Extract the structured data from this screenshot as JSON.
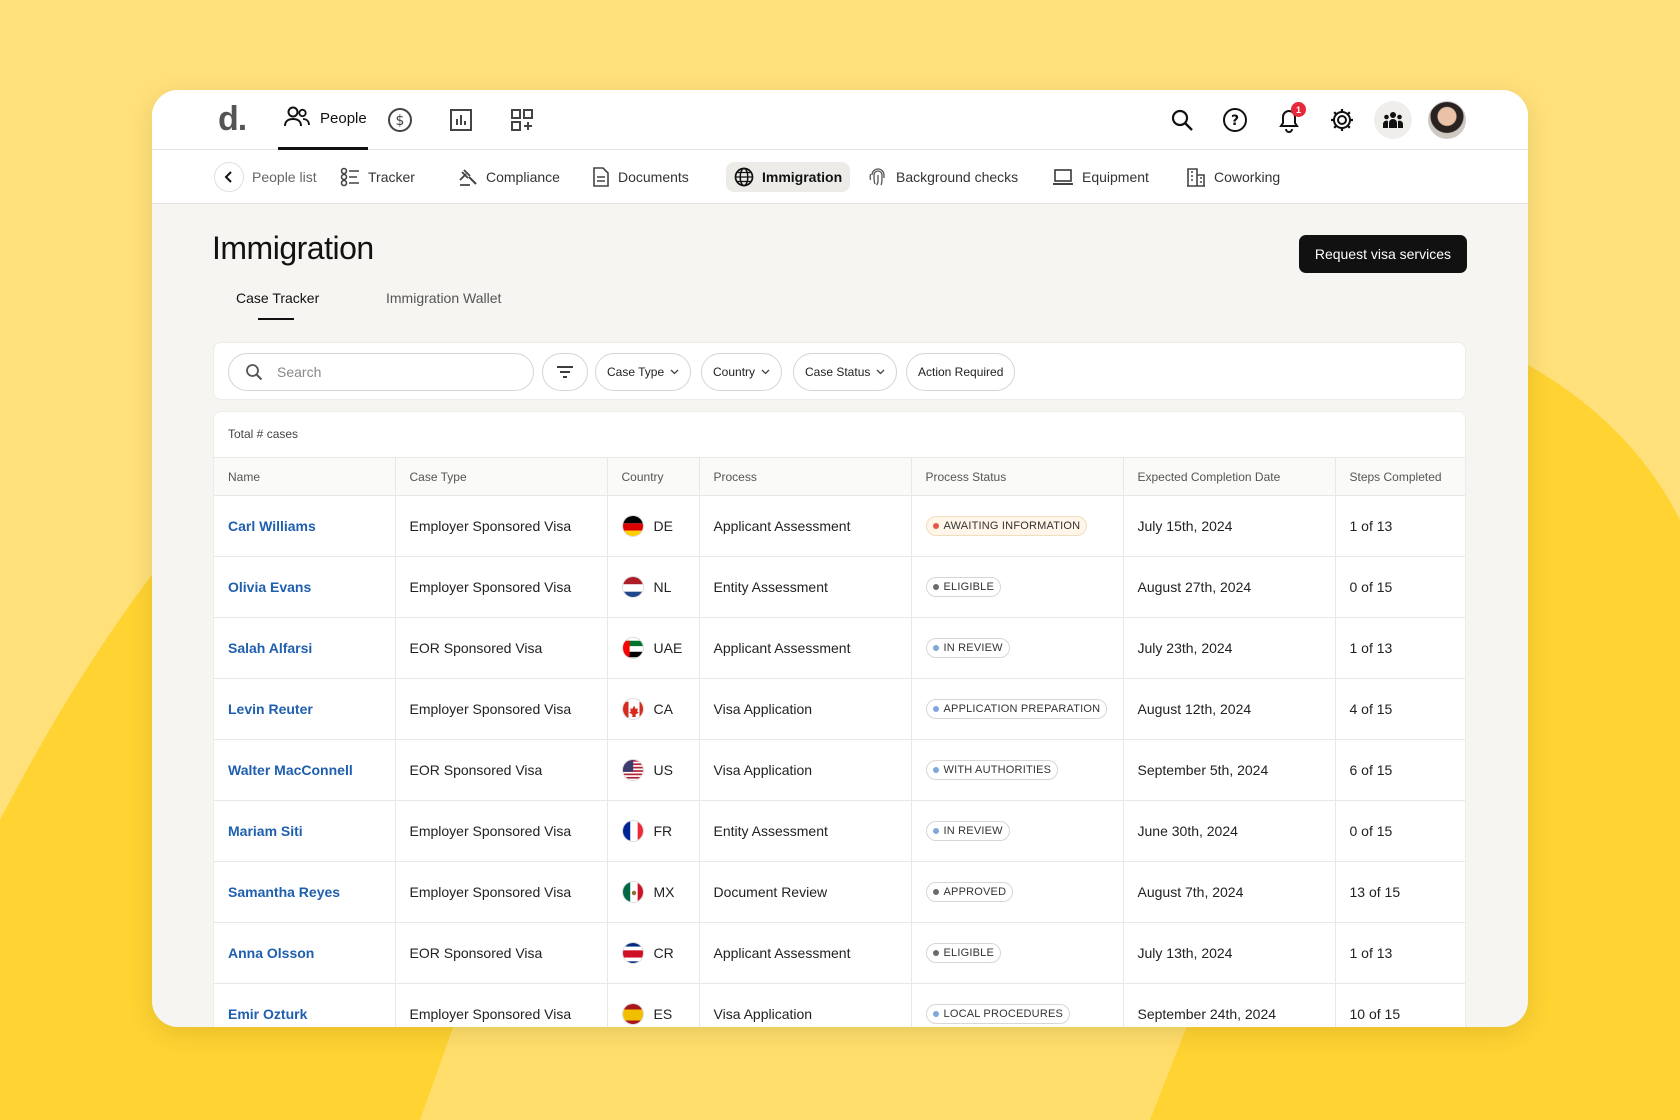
{
  "colors": {
    "accent": "#1F5FAF",
    "background": "#FFE07A",
    "dark": "#111111"
  },
  "topnav": {
    "logo": "d.",
    "active_tab": "People",
    "icons": [
      "people-icon",
      "dollar-icon",
      "chart-icon",
      "apps-icon"
    ],
    "right_icons": [
      "search-icon",
      "help-icon",
      "bell-icon",
      "gear-icon",
      "team-icon"
    ],
    "notification_count": "1"
  },
  "subnav": {
    "back_label": "People list",
    "items": [
      {
        "label": "Tracker",
        "icon": "tracker-icon"
      },
      {
        "label": "Compliance",
        "icon": "gavel-icon"
      },
      {
        "label": "Documents",
        "icon": "document-icon"
      },
      {
        "label": "Immigration",
        "icon": "globe-icon",
        "active": true
      },
      {
        "label": "Background checks",
        "icon": "fingerprint-icon"
      },
      {
        "label": "Equipment",
        "icon": "laptop-icon"
      },
      {
        "label": "Coworking",
        "icon": "building-icon"
      }
    ]
  },
  "page": {
    "title": "Immigration",
    "primary_button": "Request visa services",
    "tabs": [
      {
        "label": "Case Tracker",
        "active": true
      },
      {
        "label": "Immigration Wallet"
      }
    ]
  },
  "filters": {
    "search_placeholder": "Search",
    "chips": [
      "Case Type",
      "Country",
      "Case Status",
      "Action Required"
    ]
  },
  "table": {
    "total_label": "Total # cases",
    "columns": [
      "Name",
      "Case Type",
      "Country",
      "Process",
      "Process Status",
      "Expected Completion Date",
      "Steps Completed"
    ],
    "rows": [
      {
        "name": "Carl Williams",
        "case_type": "Employer Sponsored Visa",
        "country": "DE",
        "process": "Applicant Assessment",
        "status": "AWAITING INFORMATION",
        "status_color": "#E5574B",
        "date": "July 15th, 2024",
        "steps": "1 of 13"
      },
      {
        "name": "Olivia Evans",
        "case_type": "Employer Sponsored Visa",
        "country": "NL",
        "process": "Entity Assessment",
        "status": "ELIGIBLE",
        "status_color": "#6B6B6B",
        "date": "August 27th, 2024",
        "steps": "0 of 15"
      },
      {
        "name": "Salah Alfarsi",
        "case_type": "EOR Sponsored Visa",
        "country": "UAE",
        "process": "Applicant Assessment",
        "status": "IN REVIEW",
        "status_color": "#7FA7D9",
        "date": "July 23th, 2024",
        "steps": "1 of 13"
      },
      {
        "name": "Levin Reuter",
        "case_type": "Employer Sponsored Visa",
        "country": "CA",
        "process": "Visa Application",
        "status": "APPLICATION PREPARATION",
        "status_color": "#7FA7D9",
        "date": "August 12th, 2024",
        "steps": "4 of 15"
      },
      {
        "name": "Walter MacConnell",
        "case_type": "EOR Sponsored Visa",
        "country": "US",
        "process": "Visa Application",
        "status": "WITH AUTHORITIES",
        "status_color": "#7FA7D9",
        "date": "September 5th, 2024",
        "steps": "6 of 15"
      },
      {
        "name": "Mariam Siti",
        "case_type": "Employer Sponsored Visa",
        "country": "FR",
        "process": "Entity Assessment",
        "status": "IN REVIEW",
        "status_color": "#7FA7D9",
        "date": "June 30th, 2024",
        "steps": "0 of 15"
      },
      {
        "name": "Samantha Reyes",
        "case_type": "Employer Sponsored Visa",
        "country": "MX",
        "process": "Document Review",
        "status": "APPROVED",
        "status_color": "#6B6B6B",
        "date": "August 7th, 2024",
        "steps": "13 of 15"
      },
      {
        "name": "Anna Olsson",
        "case_type": "EOR Sponsored Visa",
        "country": "CR",
        "process": "Applicant Assessment",
        "status": "ELIGIBLE",
        "status_color": "#6B6B6B",
        "date": "July 13th, 2024",
        "steps": "1 of 13"
      },
      {
        "name": "Emir Ozturk",
        "case_type": "Employer Sponsored Visa",
        "country": "ES",
        "process": "Visa Application",
        "status": "LOCAL PROCEDURES",
        "status_color": "#7FA7D9",
        "date": "September 24th, 2024",
        "steps": "10 of 15"
      }
    ]
  }
}
